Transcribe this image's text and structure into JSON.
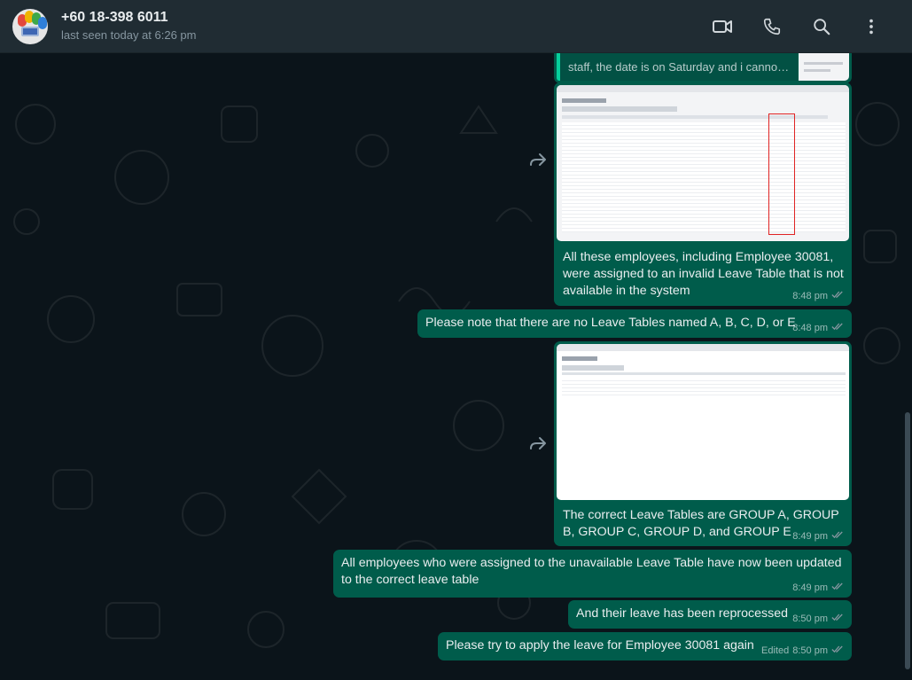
{
  "header": {
    "contact_name": "+60 18-398 6011",
    "last_seen": "last seen today at 6:26 pm"
  },
  "icons": {
    "video": "video-call-icon",
    "phone": "voice-call-icon",
    "search": "search-icon",
    "menu": "more-options-icon",
    "forward": "forward-icon",
    "tick": "double-tick-icon"
  },
  "colors": {
    "header_bg": "#202c33",
    "chat_bg": "#0b141a",
    "outgoing_bubble": "#005c4b",
    "quote_accent": "#06cf9c",
    "tick_read": "#8696a0"
  },
  "messages": [
    {
      "id": "quoted",
      "text": "staff, the date is on Saturday and i canno…"
    },
    {
      "id": "m1",
      "text": "All these employees, including Employee 30081, were assigned to an invalid Leave Table that is not available in the system",
      "time": "8:48 pm"
    },
    {
      "id": "m2",
      "text": "Please note that there are no Leave Tables named A, B, C, D, or E",
      "time": "8:48 pm"
    },
    {
      "id": "m3",
      "text": "The correct Leave Tables are GROUP A, GROUP B, GROUP C, GROUP D, and GROUP E",
      "time": "8:49 pm"
    },
    {
      "id": "m4",
      "text": "All employees who were assigned to the unavailable Leave Table have now been updated to the correct leave table",
      "time": "8:49 pm"
    },
    {
      "id": "m5",
      "text": "And their leave has been reprocessed",
      "time": "8:50 pm"
    },
    {
      "id": "m6",
      "text": "Please try to apply the leave for Employee 30081 again",
      "time": "8:50 pm",
      "edited": "Edited"
    }
  ]
}
